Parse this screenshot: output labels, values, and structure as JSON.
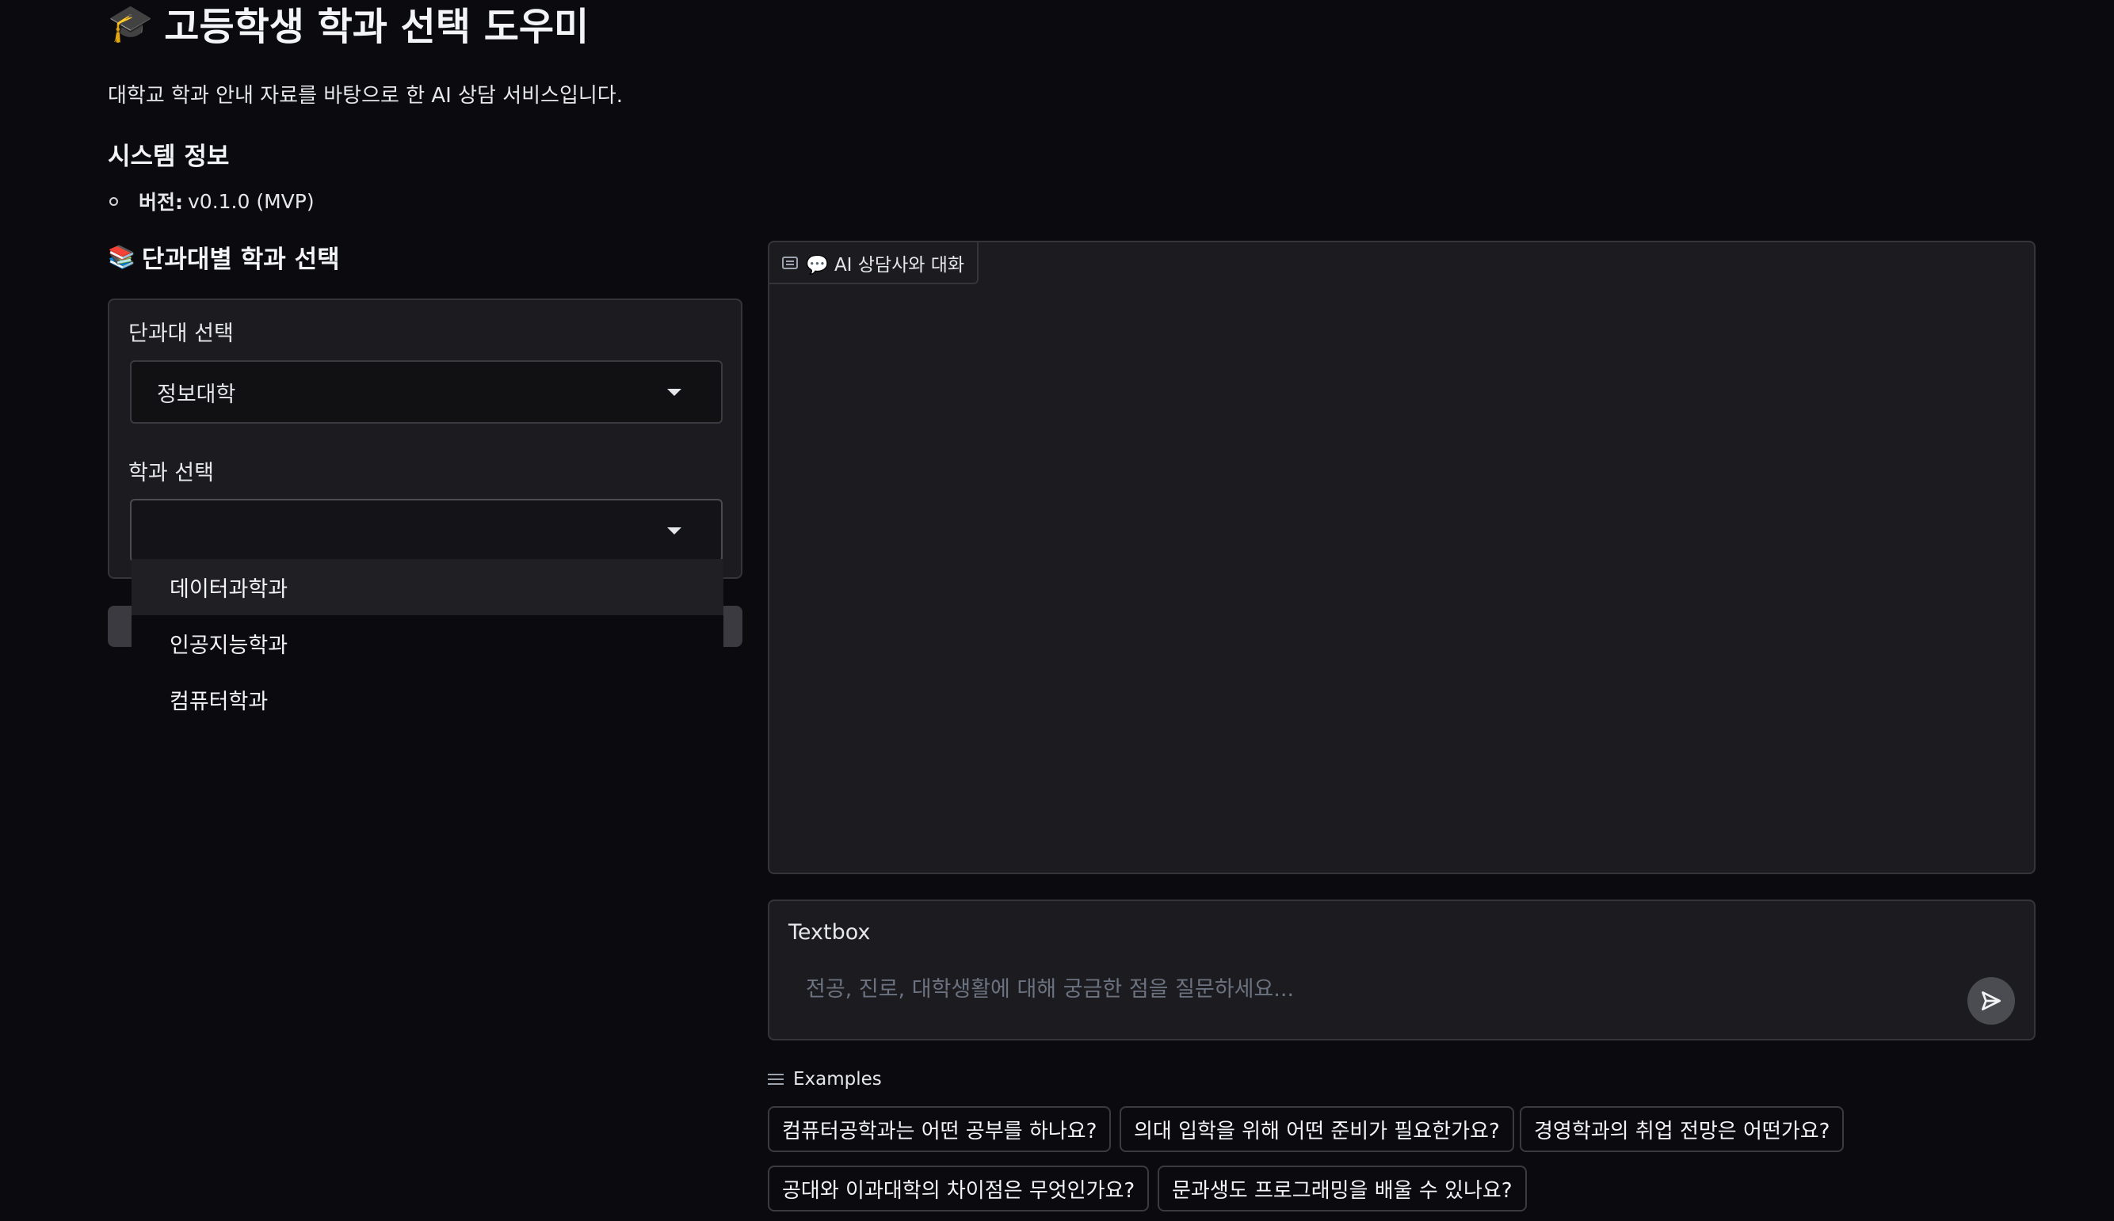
{
  "header": {
    "title_emoji": "🎓",
    "title": "고등학생 학과 선택 도우미",
    "subtitle": "대학교 학과 안내 자료를 바탕으로 한 AI 상담 서비스입니다."
  },
  "system_info": {
    "heading": "시스템 정보",
    "version_label": "버전:",
    "version_value": "v0.1.0 (MVP)"
  },
  "selection": {
    "heading_emoji": "📚",
    "heading": "단과대별 학과 선택",
    "college_label": "단과대 선택",
    "college_value": "정보대학",
    "department_label": "학과 선택",
    "department_value": "",
    "department_options": [
      "데이터과학과",
      "인공지능학과",
      "컴퓨터학과"
    ]
  },
  "chat": {
    "tab_label": "💬 AI 상담사와 대화"
  },
  "textbox": {
    "label": "Textbox",
    "placeholder": "전공, 진로, 대학생활에 대해 궁금한 점을 질문하세요..."
  },
  "examples": {
    "header": "Examples",
    "items": [
      "컴퓨터공학과는 어떤 공부를 하나요?",
      "의대 입학을 위해 어떤 준비가 필요한가요?",
      "경영학과의 취업 전망은 어떤가요?",
      "공대와 이과대학의 차이점은 무엇인가요?",
      "문과생도 프로그래밍을 배울 수 있나요?"
    ]
  },
  "colors": {
    "background": "#0b0b0f",
    "panel": "#1c1c20",
    "border": "#34343a"
  }
}
